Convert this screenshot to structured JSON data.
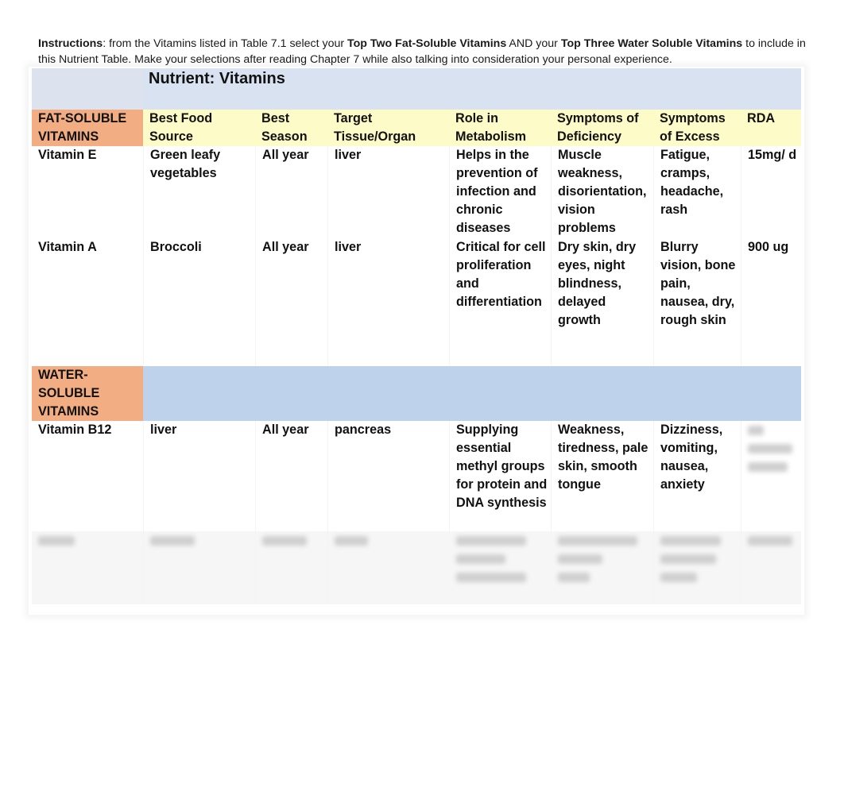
{
  "instructions": {
    "label": "Instructions",
    "text_1": ": from the Vitamins listed in Table 7.1 select your ",
    "bold_1": "Top Two Fat-Soluble Vitamins",
    "text_2": " AND your ",
    "bold_2": "Top Three Water Soluble Vitamins",
    "text_3": " to include in this Nutrient Table. Make your selections after reading Chapter 7 while also talking into consideration your personal experience."
  },
  "table": {
    "title": "Nutrient: Vitamins",
    "colors": {
      "title_bg": "#d9e2f1",
      "header_bg": "#fdfbc8",
      "category_bg": "#f2ae82",
      "section_bg": "#bed3eb"
    },
    "fat_soluble_label": "FAT-SOLUBLE VITAMINS",
    "columns": [
      "Best Food Source",
      "Best Season",
      "Target Tissue/Organ",
      "Role in Metabolism",
      "Symptoms of Deficiency",
      "Symptoms of Excess",
      "RDA"
    ],
    "fat_soluble_rows": [
      {
        "vitamin": "Vitamin E",
        "food_source": "Green leafy vegetables",
        "season": "All year",
        "target": "liver",
        "role": "Helps in the prevention of infection and chronic diseases",
        "deficiency": "Muscle weakness, disorientation, vision problems",
        "excess": "Fatigue, cramps, headache, rash",
        "rda": "15mg/ d"
      },
      {
        "vitamin": "Vitamin A",
        "food_source": "Broccoli",
        "season": "All year",
        "target": "liver",
        "role": "Critical for cell proliferation and differentiation",
        "deficiency": "Dry skin, dry eyes, night blindness, delayed growth",
        "excess": "Blurry vision, bone pain, nausea, dry, rough skin",
        "rda": "900 ug"
      }
    ],
    "water_soluble_label": "WATER-SOLUBLE VITAMINS",
    "water_soluble_rows": [
      {
        "vitamin": "Vitamin B12",
        "food_source": "liver",
        "season": "All year",
        "target": "pancreas",
        "role": "Supplying essential methyl groups for protein and DNA synthesis",
        "deficiency": "Weakness, tiredness, pale skin, smooth tongue",
        "excess": "Dizziness, vomiting, nausea, anxiety",
        "rda": ""
      }
    ]
  }
}
